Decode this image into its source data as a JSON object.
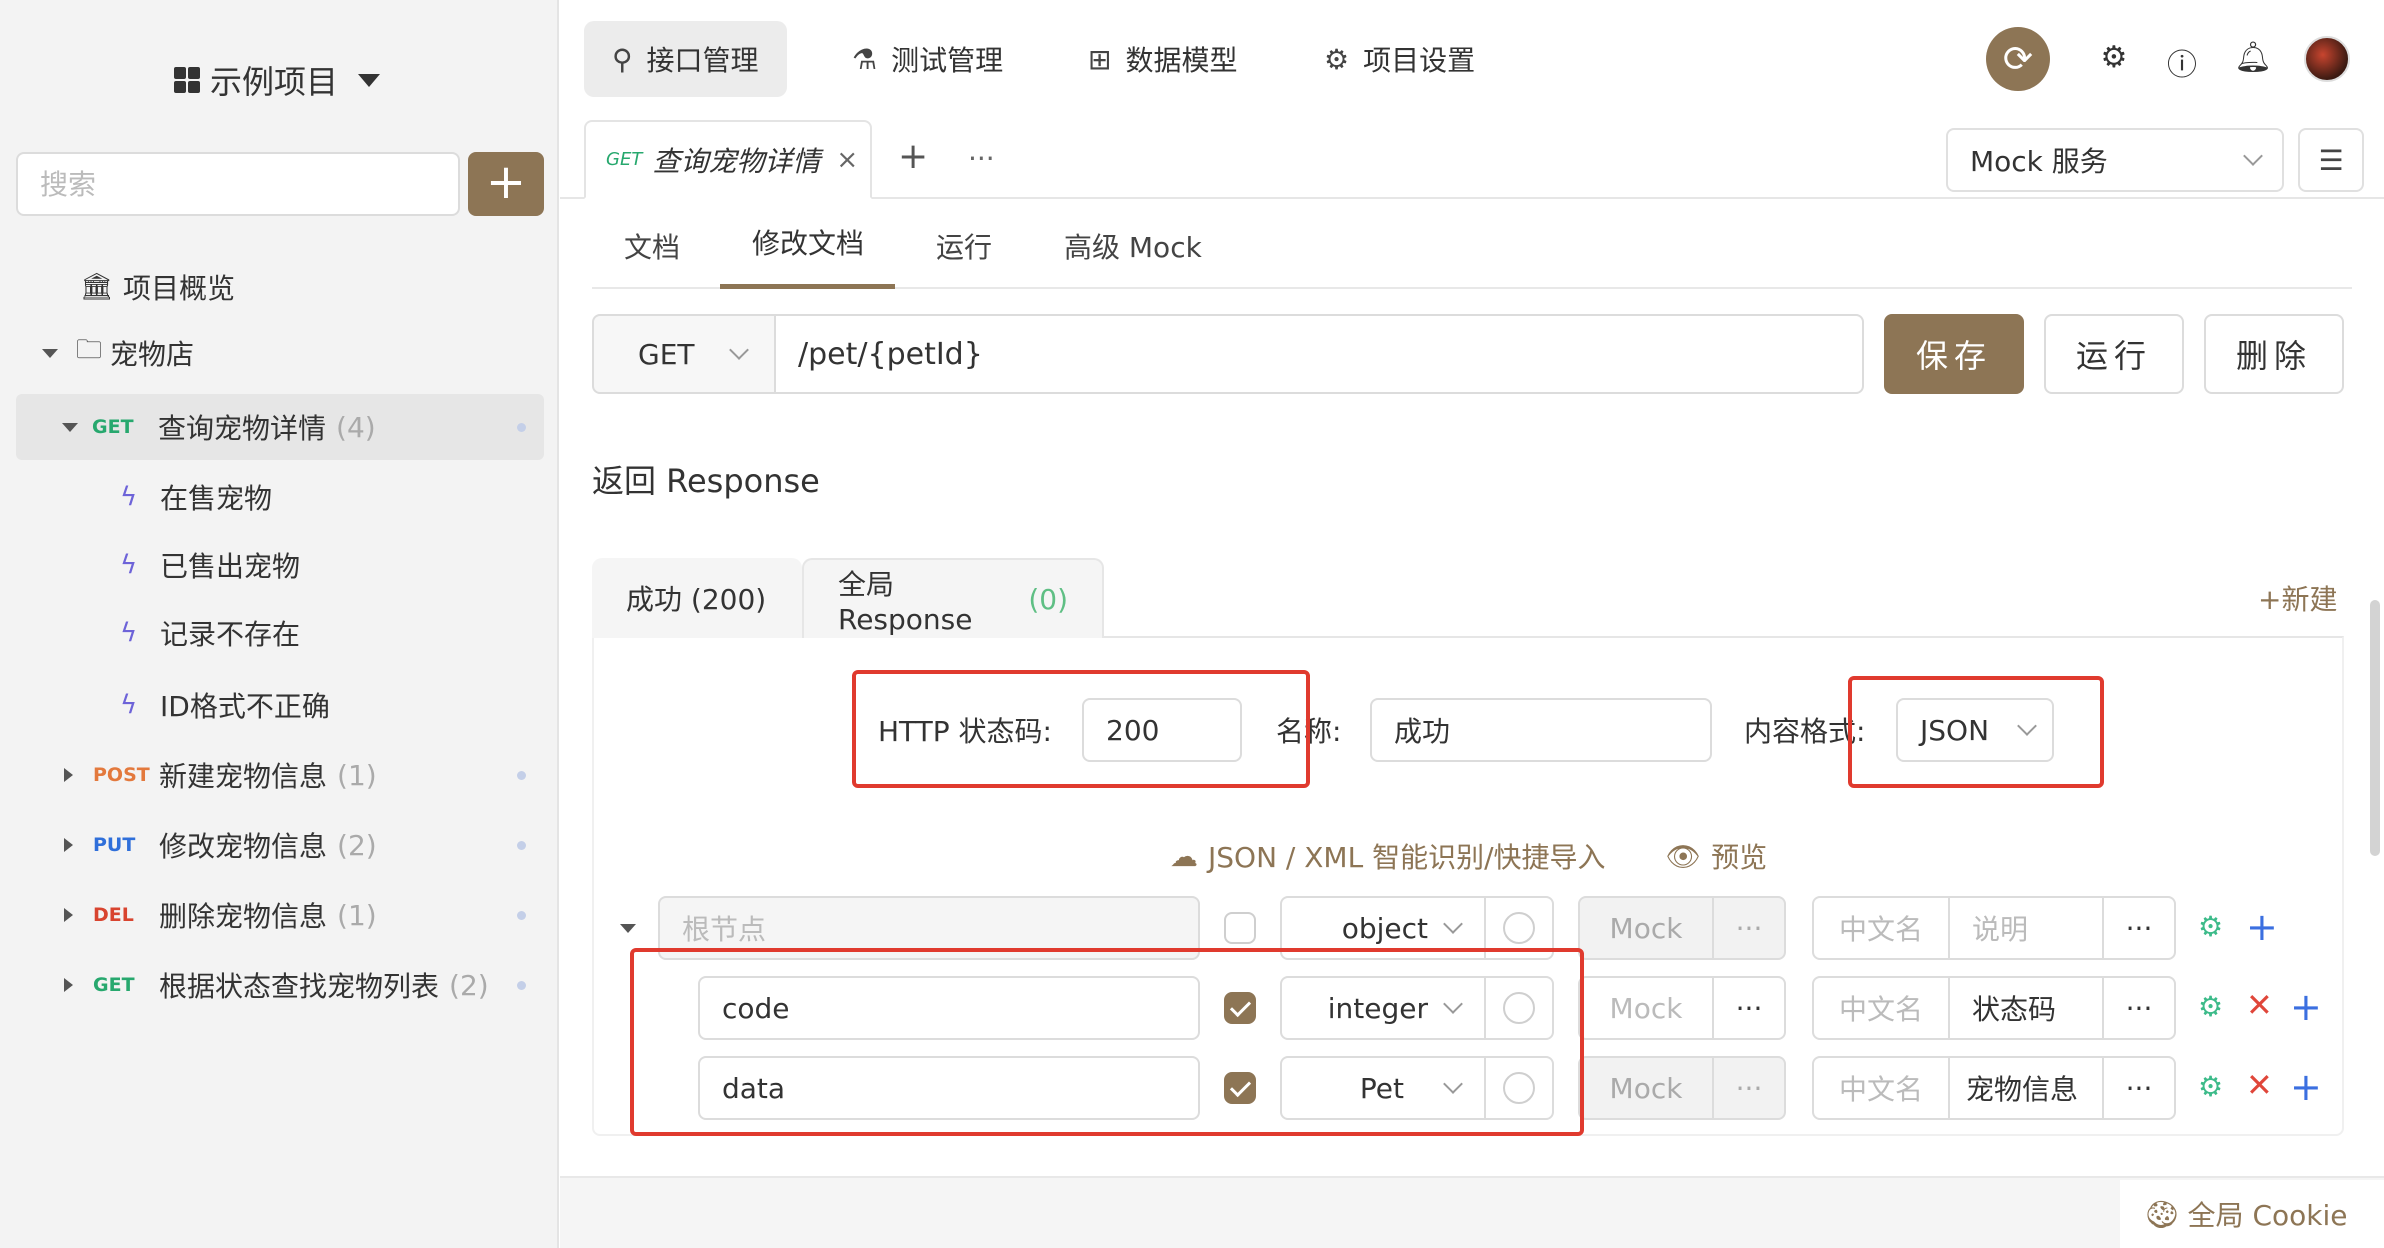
{
  "window": {
    "colors": {
      "close": "#ff5f57",
      "minimize": "#febc2e",
      "maximize": "#28c840"
    }
  },
  "project": {
    "name": "示例项目"
  },
  "sidebar": {
    "search_placeholder": "搜索",
    "add_label": "+",
    "overview": "项目概览",
    "folder": "宠物店",
    "endpoints": [
      {
        "method": "GET",
        "name": "查询宠物详情",
        "count": "(4)"
      },
      {
        "method": "POST",
        "name": "新建宠物信息",
        "count": "(1)"
      },
      {
        "method": "PUT",
        "name": "修改宠物信息",
        "count": "(2)"
      },
      {
        "method": "DEL",
        "name": "删除宠物信息",
        "count": "(1)"
      },
      {
        "method": "GET",
        "name": "根据状态查找宠物列表",
        "count": "(2)"
      }
    ],
    "cases": [
      "在售宠物",
      "已售出宠物",
      "记录不存在",
      "ID格式不正确"
    ]
  },
  "topnav": {
    "items": [
      "接口管理",
      "测试管理",
      "数据模型",
      "项目设置"
    ]
  },
  "tabbar": {
    "tab_method": "GET",
    "tab_title": "查询宠物详情",
    "close": "×",
    "plus": "+",
    "more": "···",
    "mock_service": "Mock 服务"
  },
  "subtabs": [
    "文档",
    "修改文档",
    "运行",
    "高级 Mock"
  ],
  "request": {
    "method": "GET",
    "path": "/pet/{petId}",
    "save": "保存",
    "run": "运行",
    "delete": "删除"
  },
  "response": {
    "section_title": "返回 Response",
    "tab_success": "成功 (200)",
    "tab_global": "全局 Response",
    "tab_global_count": "(0)",
    "new_label": "+新建",
    "status_label": "HTTP 状态码:",
    "status_value": "200",
    "name_label": "名称:",
    "name_value": "成功",
    "format_label": "内容格式:",
    "format_value": "JSON",
    "import_label": "JSON / XML 智能识别/快捷导入",
    "preview_label": "预览"
  },
  "schema": {
    "root_placeholder": "根节点",
    "mock_placeholder": "Mock",
    "cn_placeholder": "中文名",
    "desc_placeholder": "说明",
    "more": "···",
    "rows": [
      {
        "name": "",
        "type": "object",
        "required": false,
        "desc": ""
      },
      {
        "name": "code",
        "type": "integer",
        "required": true,
        "desc": "状态码"
      },
      {
        "name": "data",
        "type": "Pet",
        "required": true,
        "desc": "宠物信息"
      }
    ]
  },
  "footer": {
    "cookie": "全局 Cookie"
  },
  "colors": {
    "accent": "#8d7555",
    "highlight": "#e03a2e"
  }
}
